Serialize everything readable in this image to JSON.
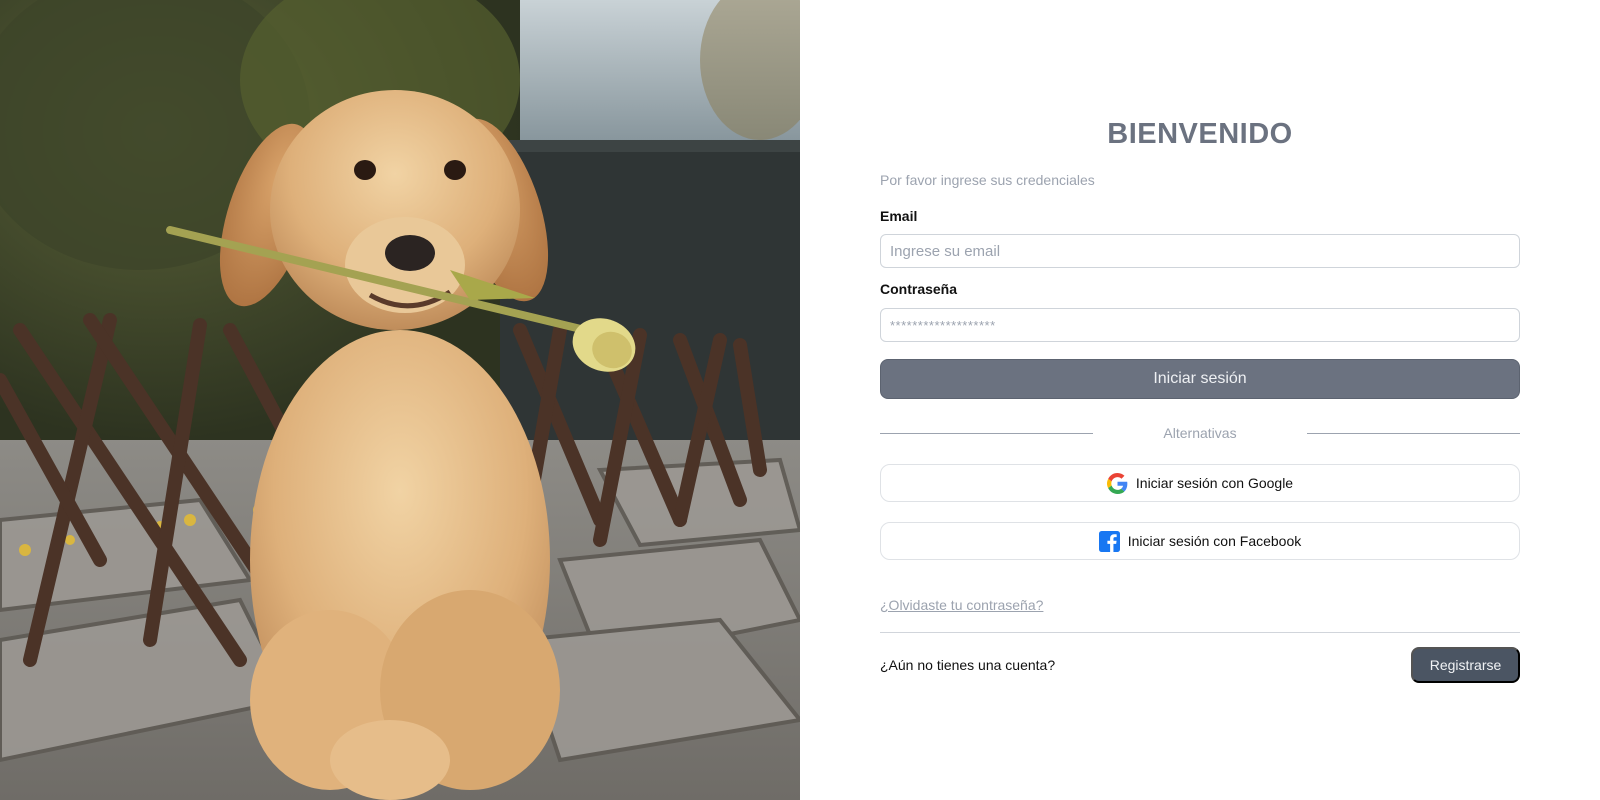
{
  "photo": {
    "alt": "dog-with-tulip-photo"
  },
  "login": {
    "title": "BIENVENIDO",
    "subtitle": "Por favor ingrese sus credenciales",
    "email_label": "Email",
    "email_placeholder": "Ingrese su email",
    "password_label": "Contraseña",
    "password_placeholder": "*******************",
    "submit_label": "Iniciar sesión",
    "alternatives_label": "Alternativas",
    "google_label": "Iniciar sesión con Google",
    "facebook_label": "Iniciar sesión con Facebook",
    "forgot_label": "¿Olvidaste tu contraseña?",
    "no_account_label": "¿Aún no tienes una cuenta?",
    "register_label": "Registrarse"
  },
  "icons": {
    "google": "google-icon",
    "facebook": "facebook-icon"
  },
  "colors": {
    "primary_button": "#6b7280",
    "register_button": "#4b5563",
    "muted_text": "#9ca3af",
    "facebook_blue": "#1877f2"
  }
}
